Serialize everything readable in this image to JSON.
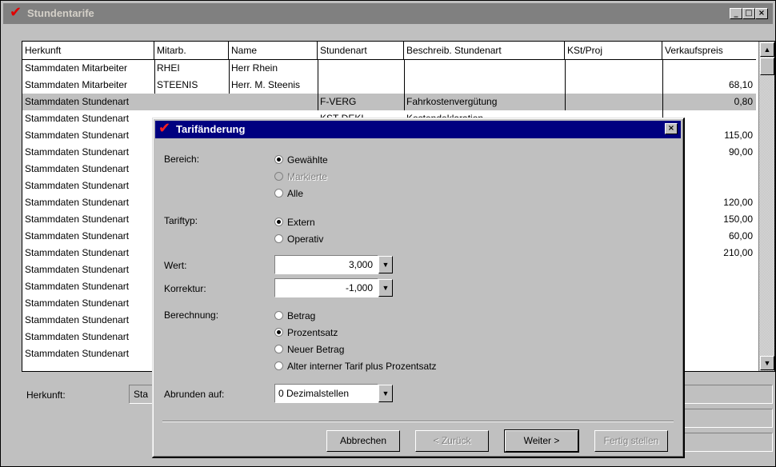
{
  "window": {
    "title": "Stundentarife",
    "controls": [
      "_",
      "□",
      "×"
    ]
  },
  "grid": {
    "columns": [
      "Herkunft",
      "Mitarb.",
      "Name",
      "Stundenart",
      "Beschreib. Stundenart",
      "KSt/Proj",
      "Verkaufspreis"
    ],
    "rows": [
      {
        "herkunft": "Stammdaten Mitarbeiter",
        "mitarb": "RHEI",
        "name": "Herr Rhein",
        "stundenart": "",
        "beschreib": "",
        "kst": "",
        "preis": ""
      },
      {
        "herkunft": "Stammdaten Mitarbeiter",
        "mitarb": "STEENIS",
        "name": "Herr. M. Steenis",
        "stundenart": "",
        "beschreib": "",
        "kst": "",
        "preis": "68,10"
      },
      {
        "herkunft": "Stammdaten Stundenart",
        "mitarb": "",
        "name": "",
        "stundenart": "F-VERG",
        "beschreib": "Fahrkostenvergütung",
        "kst": "",
        "preis": "0,80"
      },
      {
        "herkunft": "Stammdaten Stundenart",
        "mitarb": "",
        "name": "",
        "stundenart": "KST-DEKL",
        "beschreib": "Kostendeklaration",
        "kst": "",
        "preis": ""
      },
      {
        "herkunft": "Stammdaten Stundenart",
        "mitarb": "",
        "name": "",
        "stundenart": "",
        "beschreib": "",
        "kst": "",
        "preis": "115,00"
      },
      {
        "herkunft": "Stammdaten Stundenart",
        "mitarb": "",
        "name": "",
        "stundenart": "",
        "beschreib": "",
        "kst": "",
        "preis": "90,00"
      },
      {
        "herkunft": "Stammdaten Stundenart",
        "mitarb": "",
        "name": "",
        "stundenart": "",
        "beschreib": "",
        "kst": "",
        "preis": ""
      },
      {
        "herkunft": "Stammdaten Stundenart",
        "mitarb": "",
        "name": "",
        "stundenart": "",
        "beschreib": "",
        "kst": "",
        "preis": ""
      },
      {
        "herkunft": "Stammdaten Stundenart",
        "mitarb": "",
        "name": "",
        "stundenart": "",
        "beschreib": "",
        "kst": "",
        "preis": "120,00"
      },
      {
        "herkunft": "Stammdaten Stundenart",
        "mitarb": "",
        "name": "",
        "stundenart": "",
        "beschreib": "",
        "kst": "",
        "preis": "150,00"
      },
      {
        "herkunft": "Stammdaten Stundenart",
        "mitarb": "",
        "name": "",
        "stundenart": "",
        "beschreib": "",
        "kst": "",
        "preis": "60,00"
      },
      {
        "herkunft": "Stammdaten Stundenart",
        "mitarb": "",
        "name": "",
        "stundenart": "",
        "beschreib": "",
        "kst": "",
        "preis": "210,00"
      },
      {
        "herkunft": "Stammdaten Stundenart",
        "mitarb": "",
        "name": "",
        "stundenart": "",
        "beschreib": "",
        "kst": "",
        "preis": ""
      },
      {
        "herkunft": "Stammdaten Stundenart",
        "mitarb": "",
        "name": "",
        "stundenart": "",
        "beschreib": "",
        "kst": "",
        "preis": ""
      },
      {
        "herkunft": "Stammdaten Stundenart",
        "mitarb": "",
        "name": "",
        "stundenart": "",
        "beschreib": "",
        "kst": "",
        "preis": ""
      },
      {
        "herkunft": "Stammdaten Stundenart",
        "mitarb": "",
        "name": "",
        "stundenart": "",
        "beschreib": "",
        "kst": "",
        "preis": ""
      },
      {
        "herkunft": "Stammdaten Stundenart",
        "mitarb": "",
        "name": "",
        "stundenart": "",
        "beschreib": "",
        "kst": "",
        "preis": ""
      },
      {
        "herkunft": "Stammdaten Stundenart",
        "mitarb": "",
        "name": "",
        "stundenart": "",
        "beschreib": "",
        "kst": "",
        "preis": ""
      }
    ],
    "selected_row": 2
  },
  "bottom": {
    "herkunft_label": "Herkunft:",
    "herkunft_value": "Sta"
  },
  "dialog": {
    "title": "Tarifänderung",
    "bereich_label": "Bereich:",
    "bereich_options": [
      "Gewählte",
      "Markierte",
      "Alle"
    ],
    "bereich_selected": "Gewählte",
    "tariftyp_label": "Tariftyp:",
    "tariftyp_options": [
      "Extern",
      "Operativ"
    ],
    "tariftyp_selected": "Extern",
    "wert_label": "Wert:",
    "wert_value": "3,000",
    "korrektur_label": "Korrektur:",
    "korrektur_value": "-1,000",
    "berechnung_label": "Berechnung:",
    "berechnung_options": [
      "Betrag",
      "Prozentsatz",
      "Neuer Betrag",
      "Alter interner Tarif plus Prozentsatz"
    ],
    "berechnung_selected": "Prozentsatz",
    "abrunden_label": "Abrunden auf:",
    "abrunden_value": "0 Dezimalstellen",
    "buttons": {
      "abbrechen": "Abbrechen",
      "zurueck": "< Zurück",
      "weiter": "Weiter >",
      "fertig": "Fertig stellen"
    }
  },
  "colors": {
    "dialog_title_bg": "#000080",
    "main_title_bg": "#808080",
    "checkmark": "#e00000",
    "face": "#c0c0c0"
  }
}
